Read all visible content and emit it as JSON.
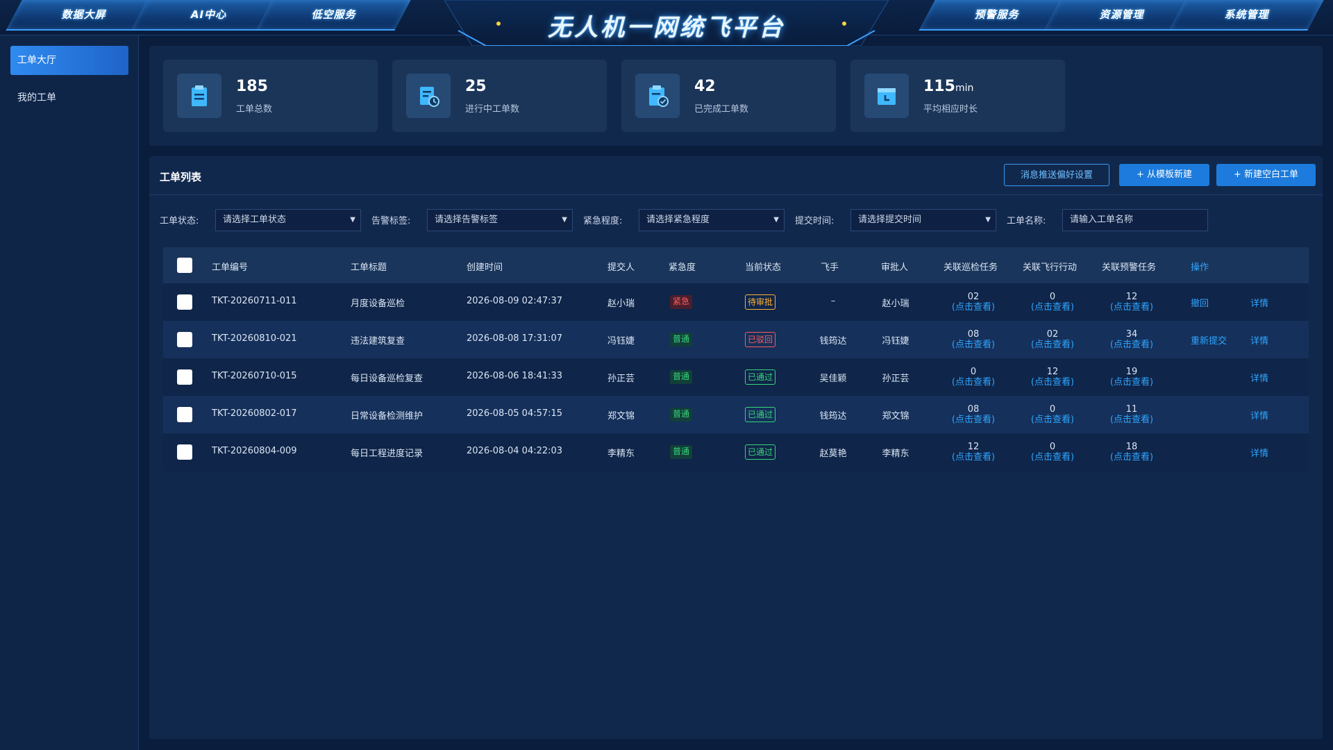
{
  "nav": {
    "left": [
      "数据大屏",
      "AI中心",
      "低空服务"
    ],
    "right": [
      "预警服务",
      "资源管理",
      "系统管理"
    ]
  },
  "app_title": "无人机一网统飞平台",
  "sidebar": {
    "items": [
      {
        "label": "工单大厅",
        "active": true
      },
      {
        "label": "我的工单",
        "active": false
      }
    ]
  },
  "stats": [
    {
      "value": "185",
      "unit": "",
      "label": "工单总数",
      "icon": "clipboard-icon"
    },
    {
      "value": "25",
      "unit": "",
      "label": "进行中工单数",
      "icon": "document-clock-icon"
    },
    {
      "value": "42",
      "unit": "",
      "label": "已完成工单数",
      "icon": "clipboard-check-icon"
    },
    {
      "value": "115",
      "unit": "min",
      "label": "平均相应时长",
      "icon": "calendar-clock-icon"
    }
  ],
  "list": {
    "title": "工单列表",
    "buttons": {
      "preferences": "消息推送偏好设置",
      "from_template": "+ 从模板新建",
      "new_blank": "+ 新建空白工单"
    }
  },
  "filters": {
    "status": {
      "label": "工单状态:",
      "placeholder": "请选择工单状态"
    },
    "alarm_tag": {
      "label": "告警标签:",
      "placeholder": "请选择告警标签"
    },
    "urgency": {
      "label": "紧急程度:",
      "placeholder": "请选择紧急程度"
    },
    "submit_time": {
      "label": "提交时间:",
      "placeholder": "请选择提交时间"
    },
    "name": {
      "label": "工单名称:",
      "placeholder": "请输入工单名称"
    }
  },
  "table": {
    "headers": {
      "id": "工单编号",
      "title": "工单标题",
      "created": "创建时间",
      "submitter": "提交人",
      "urgency": "紧急度",
      "status": "当前状态",
      "pilot": "飞手",
      "approver": "审批人",
      "patrol": "关联巡检任务",
      "flight": "关联飞行行动",
      "alert": "关联预警任务",
      "ops": "操作"
    },
    "view_link": "(点击查看)",
    "detail_label": "详情",
    "rows": [
      {
        "id": "TKT-20260711-011",
        "title": "月度设备巡检",
        "created": "2026-08-09 02:47:37",
        "submitter": "赵小瑞",
        "urgency": "紧急",
        "urgency_type": "urgent",
        "status": "待审批",
        "status_type": "wait",
        "pilot": "–",
        "approver": "赵小瑞",
        "patrol": "02",
        "flight": "0",
        "alert": "12",
        "action": "撤回"
      },
      {
        "id": "TKT-20260810-021",
        "title": "违法建筑复查",
        "created": "2026-08-08 17:31:07",
        "submitter": "冯钰婕",
        "urgency": "普通",
        "urgency_type": "normal",
        "status": "已驳回",
        "status_type": "reject",
        "pilot": "钱筠达",
        "approver": "冯钰婕",
        "patrol": "08",
        "flight": "02",
        "alert": "34",
        "action": "重新提交"
      },
      {
        "id": "TKT-20260710-015",
        "title": "每日设备巡检复查",
        "created": "2026-08-06 18:41:33",
        "submitter": "孙正芸",
        "urgency": "普通",
        "urgency_type": "normal",
        "status": "已通过",
        "status_type": "pass",
        "pilot": "吴佳颖",
        "approver": "孙正芸",
        "patrol": "0",
        "flight": "12",
        "alert": "19",
        "action": ""
      },
      {
        "id": "TKT-20260802-017",
        "title": "日常设备检测维护",
        "created": "2026-08-05 04:57:15",
        "submitter": "郑文锦",
        "urgency": "普通",
        "urgency_type": "normal",
        "status": "已通过",
        "status_type": "pass",
        "pilot": "钱筠达",
        "approver": "郑文锦",
        "patrol": "08",
        "flight": "0",
        "alert": "11",
        "action": ""
      },
      {
        "id": "TKT-20260804-009",
        "title": "每日工程进度记录",
        "created": "2026-08-04 04:22:03",
        "submitter": "李精东",
        "urgency": "普通",
        "urgency_type": "normal",
        "status": "已通过",
        "status_type": "pass",
        "pilot": "赵莫艳",
        "approver": "李精东",
        "patrol": "12",
        "flight": "0",
        "alert": "18",
        "action": ""
      }
    ]
  }
}
